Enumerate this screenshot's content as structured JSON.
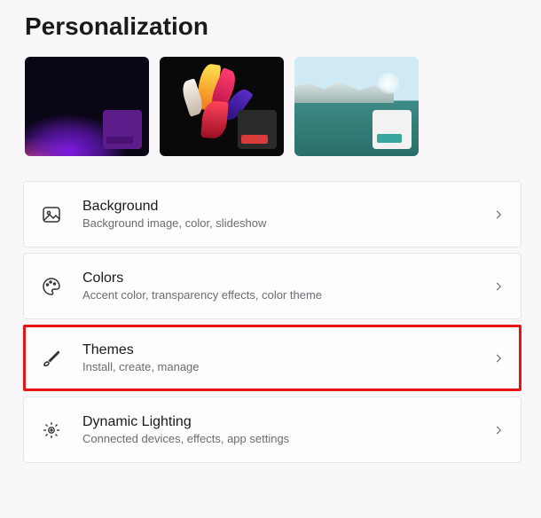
{
  "page": {
    "title": "Personalization"
  },
  "themes": [
    {
      "name": "purple-glow",
      "accent": "#5c1d8a"
    },
    {
      "name": "dark-flower",
      "accent": "#d93a3a"
    },
    {
      "name": "lake-light",
      "accent": "#3aa6a0"
    }
  ],
  "cards": {
    "background": {
      "title": "Background",
      "subtitle": "Background image, color, slideshow"
    },
    "colors": {
      "title": "Colors",
      "subtitle": "Accent color, transparency effects, color theme"
    },
    "themes": {
      "title": "Themes",
      "subtitle": "Install, create, manage"
    },
    "dynamic_lighting": {
      "title": "Dynamic Lighting",
      "subtitle": "Connected devices, effects, app settings"
    }
  }
}
